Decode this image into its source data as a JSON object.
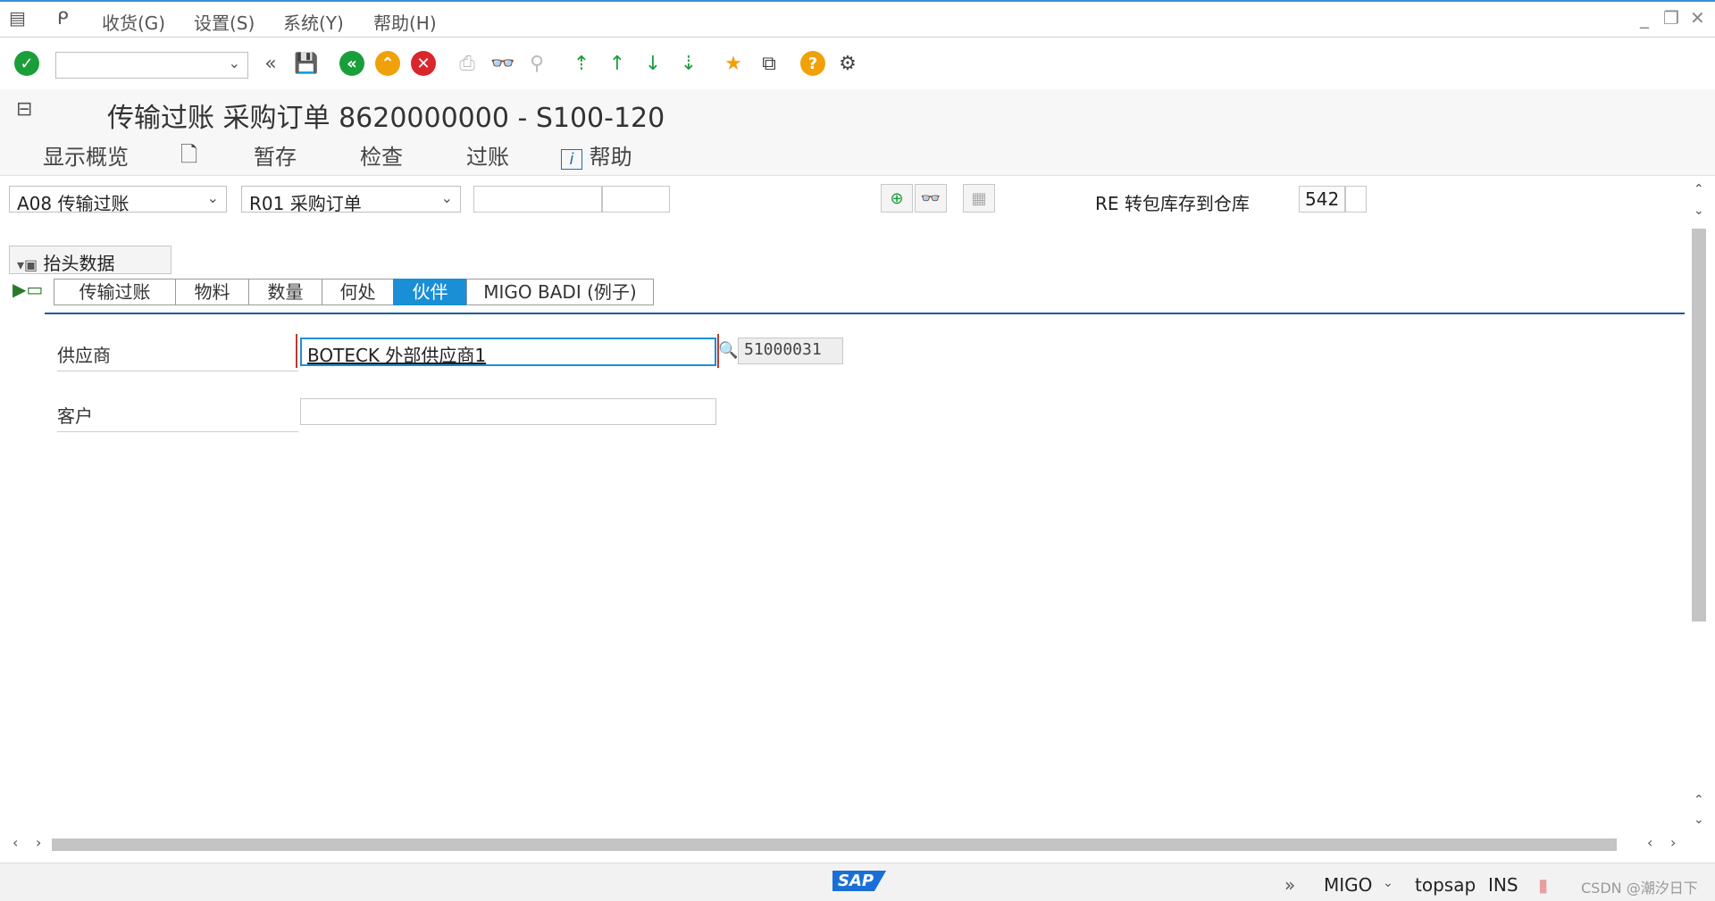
{
  "menubar": {
    "items": [
      "收货(G)",
      "设置(S)",
      "系统(Y)",
      "帮助(H)"
    ]
  },
  "toolbar": {
    "command_value": "",
    "help_glyph": "?"
  },
  "title": "传输过账 采购订单 8620000000 - S100-120",
  "app_toolbar": {
    "overview": "显示概览",
    "hold": "暂存",
    "check": "检查",
    "post": "过账",
    "help": "帮助"
  },
  "header": {
    "action_select": "A08 传输过账",
    "ref_select": "R01 采购订单",
    "ref_input1": "",
    "ref_input2": "",
    "movement_label": "RE 转包库存到仓库",
    "movement_type": "542",
    "movement_extra": ""
  },
  "header_data_toggle": "抬头数据",
  "tabs": [
    "传输过账",
    "物料",
    "数量",
    "何处",
    "伙伴",
    "MIGO BADI (例子)"
  ],
  "partner": {
    "vendor_label": "供应商",
    "vendor_value": "BOTECK 外部供应商1",
    "vendor_number": "51000031",
    "customer_label": "客户",
    "customer_value": ""
  },
  "statusbar": {
    "logo": "SAP",
    "transaction": "MIGO",
    "server": "topsap",
    "mode": "INS",
    "watermark": "CSDN @潮汐日下"
  },
  "colors": {
    "accent": "#1a8fd6",
    "green": "#1a9e3a",
    "orange": "#f0a10a",
    "red": "#d9262c"
  }
}
